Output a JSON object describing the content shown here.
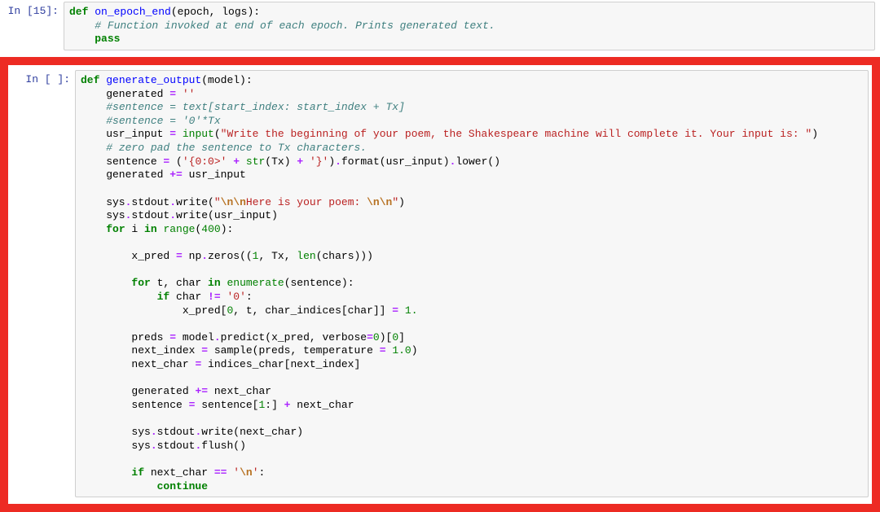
{
  "cells": [
    {
      "prompt": "In [15]:",
      "tokens": [
        {
          "cls": "kw",
          "t": "def"
        },
        {
          "t": " "
        },
        {
          "cls": "fn-def",
          "t": "on_epoch_end"
        },
        {
          "t": "(epoch, logs):\n"
        },
        {
          "t": "    "
        },
        {
          "cls": "comment",
          "t": "# Function invoked at end of each epoch. Prints generated text."
        },
        {
          "t": "\n"
        },
        {
          "t": "    "
        },
        {
          "cls": "kw",
          "t": "pass"
        }
      ]
    },
    {
      "prompt": "In [ ]:",
      "tokens": [
        {
          "cls": "kw",
          "t": "def"
        },
        {
          "t": " "
        },
        {
          "cls": "fn-def",
          "t": "generate_output"
        },
        {
          "t": "(model):\n"
        },
        {
          "t": "    generated "
        },
        {
          "cls": "op",
          "t": "="
        },
        {
          "t": " "
        },
        {
          "cls": "str",
          "t": "''"
        },
        {
          "t": "\n"
        },
        {
          "t": "    "
        },
        {
          "cls": "comment",
          "t": "#sentence = text[start_index: start_index + Tx]"
        },
        {
          "t": "\n"
        },
        {
          "t": "    "
        },
        {
          "cls": "comment",
          "t": "#sentence = '0'*Tx"
        },
        {
          "t": "\n"
        },
        {
          "t": "    usr_input "
        },
        {
          "cls": "op",
          "t": "="
        },
        {
          "t": " "
        },
        {
          "cls": "builtin",
          "t": "input"
        },
        {
          "t": "("
        },
        {
          "cls": "str",
          "t": "\"Write the beginning of your poem, the Shakespeare machine will complete it. Your input is: \""
        },
        {
          "t": ")\n"
        },
        {
          "t": "    "
        },
        {
          "cls": "comment",
          "t": "# zero pad the sentence to Tx characters."
        },
        {
          "t": "\n"
        },
        {
          "t": "    sentence "
        },
        {
          "cls": "op",
          "t": "="
        },
        {
          "t": " ("
        },
        {
          "cls": "str",
          "t": "'{0:0>'"
        },
        {
          "t": " "
        },
        {
          "cls": "op",
          "t": "+"
        },
        {
          "t": " "
        },
        {
          "cls": "builtin",
          "t": "str"
        },
        {
          "t": "(Tx) "
        },
        {
          "cls": "op",
          "t": "+"
        },
        {
          "t": " "
        },
        {
          "cls": "str",
          "t": "'}'"
        },
        {
          "t": ")"
        },
        {
          "cls": "op",
          "t": "."
        },
        {
          "t": "format(usr_input)"
        },
        {
          "cls": "op",
          "t": "."
        },
        {
          "t": "lower()\n"
        },
        {
          "t": "    generated "
        },
        {
          "cls": "op",
          "t": "+="
        },
        {
          "t": " usr_input\n"
        },
        {
          "t": "\n"
        },
        {
          "t": "    sys"
        },
        {
          "cls": "op",
          "t": "."
        },
        {
          "t": "stdout"
        },
        {
          "cls": "op",
          "t": "."
        },
        {
          "t": "write("
        },
        {
          "cls": "str",
          "t": "\""
        },
        {
          "cls": "esc",
          "t": "\\n\\n"
        },
        {
          "cls": "str",
          "t": "Here is your poem: "
        },
        {
          "cls": "esc",
          "t": "\\n\\n"
        },
        {
          "cls": "str",
          "t": "\""
        },
        {
          "t": ")\n"
        },
        {
          "t": "    sys"
        },
        {
          "cls": "op",
          "t": "."
        },
        {
          "t": "stdout"
        },
        {
          "cls": "op",
          "t": "."
        },
        {
          "t": "write(usr_input)\n"
        },
        {
          "t": "    "
        },
        {
          "cls": "kw",
          "t": "for"
        },
        {
          "t": " i "
        },
        {
          "cls": "kw",
          "t": "in"
        },
        {
          "t": " "
        },
        {
          "cls": "builtin",
          "t": "range"
        },
        {
          "t": "("
        },
        {
          "cls": "num",
          "t": "400"
        },
        {
          "t": "):\n"
        },
        {
          "t": "\n"
        },
        {
          "t": "        x_pred "
        },
        {
          "cls": "op",
          "t": "="
        },
        {
          "t": " np"
        },
        {
          "cls": "op",
          "t": "."
        },
        {
          "t": "zeros(("
        },
        {
          "cls": "num",
          "t": "1"
        },
        {
          "t": ", Tx, "
        },
        {
          "cls": "builtin",
          "t": "len"
        },
        {
          "t": "(chars)))\n"
        },
        {
          "t": "\n"
        },
        {
          "t": "        "
        },
        {
          "cls": "kw",
          "t": "for"
        },
        {
          "t": " t, char "
        },
        {
          "cls": "kw",
          "t": "in"
        },
        {
          "t": " "
        },
        {
          "cls": "builtin",
          "t": "enumerate"
        },
        {
          "t": "(sentence):\n"
        },
        {
          "t": "            "
        },
        {
          "cls": "kw",
          "t": "if"
        },
        {
          "t": " char "
        },
        {
          "cls": "op",
          "t": "!="
        },
        {
          "t": " "
        },
        {
          "cls": "str",
          "t": "'0'"
        },
        {
          "t": ":\n"
        },
        {
          "t": "                x_pred["
        },
        {
          "cls": "num",
          "t": "0"
        },
        {
          "t": ", t, char_indices[char]] "
        },
        {
          "cls": "op",
          "t": "="
        },
        {
          "t": " "
        },
        {
          "cls": "num",
          "t": "1."
        },
        {
          "t": "\n"
        },
        {
          "t": "\n"
        },
        {
          "t": "        preds "
        },
        {
          "cls": "op",
          "t": "="
        },
        {
          "t": " model"
        },
        {
          "cls": "op",
          "t": "."
        },
        {
          "t": "predict(x_pred, verbose"
        },
        {
          "cls": "op",
          "t": "="
        },
        {
          "cls": "num",
          "t": "0"
        },
        {
          "t": ")["
        },
        {
          "cls": "num",
          "t": "0"
        },
        {
          "t": "]\n"
        },
        {
          "t": "        next_index "
        },
        {
          "cls": "op",
          "t": "="
        },
        {
          "t": " sample(preds, temperature "
        },
        {
          "cls": "op",
          "t": "="
        },
        {
          "t": " "
        },
        {
          "cls": "num",
          "t": "1.0"
        },
        {
          "t": ")\n"
        },
        {
          "t": "        next_char "
        },
        {
          "cls": "op",
          "t": "="
        },
        {
          "t": " indices_char[next_index]\n"
        },
        {
          "t": "\n"
        },
        {
          "t": "        generated "
        },
        {
          "cls": "op",
          "t": "+="
        },
        {
          "t": " next_char\n"
        },
        {
          "t": "        sentence "
        },
        {
          "cls": "op",
          "t": "="
        },
        {
          "t": " sentence["
        },
        {
          "cls": "num",
          "t": "1"
        },
        {
          "t": ":] "
        },
        {
          "cls": "op",
          "t": "+"
        },
        {
          "t": " next_char\n"
        },
        {
          "t": "\n"
        },
        {
          "t": "        sys"
        },
        {
          "cls": "op",
          "t": "."
        },
        {
          "t": "stdout"
        },
        {
          "cls": "op",
          "t": "."
        },
        {
          "t": "write(next_char)\n"
        },
        {
          "t": "        sys"
        },
        {
          "cls": "op",
          "t": "."
        },
        {
          "t": "stdout"
        },
        {
          "cls": "op",
          "t": "."
        },
        {
          "t": "flush()\n"
        },
        {
          "t": "\n"
        },
        {
          "t": "        "
        },
        {
          "cls": "kw",
          "t": "if"
        },
        {
          "t": " next_char "
        },
        {
          "cls": "op",
          "t": "=="
        },
        {
          "t": " "
        },
        {
          "cls": "str",
          "t": "'"
        },
        {
          "cls": "esc",
          "t": "\\n"
        },
        {
          "cls": "str",
          "t": "'"
        },
        {
          "t": ":\n"
        },
        {
          "t": "            "
        },
        {
          "cls": "kw",
          "t": "continue"
        }
      ]
    }
  ]
}
